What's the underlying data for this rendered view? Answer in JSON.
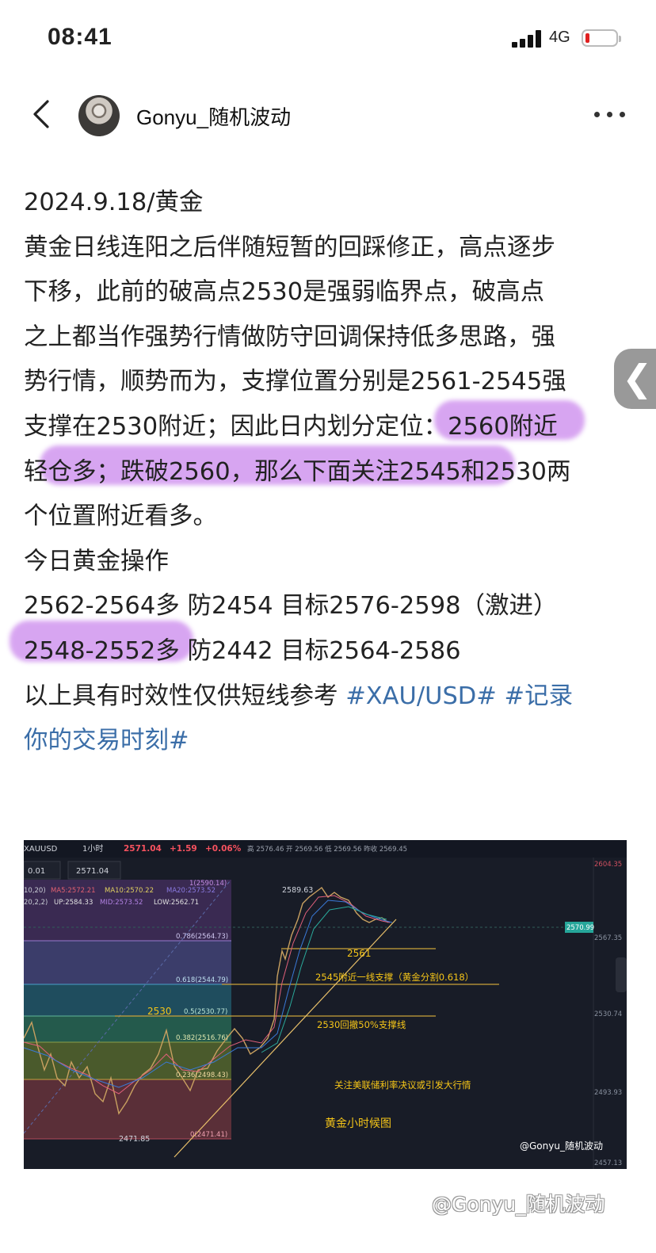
{
  "status_bar": {
    "time": "08:41",
    "network": "4G",
    "battery_level": 0.1
  },
  "header": {
    "author": "Gonyu_随机波动"
  },
  "post": {
    "lines": [
      "2024.9.18/黄金",
      "黄金日线连阳之后伴随短暂的回踩修正，高点逐步",
      "下移，此前的破高点2530是强弱临界点，破高点",
      "之上都当作强势行情做防守回调保持低多思路，强",
      "势行情，顺势而为，支撑位置分别是2561-2545强",
      "支撑在2530附近；因此日内划分定位：2560附近",
      "轻仓多；跌破2560，那么下面关注2545和2530两",
      "个位置附近看多。",
      "今日黄金操作",
      "2562-2564多 防2454 目标2576-2598（激进）",
      "2548-2552多 防2442 目标2564-2586"
    ],
    "last_line_text": "以上具有时效性仅供短线参考 ",
    "tag_1": "#XAU/USD#",
    "tag_2a": "#记录",
    "tag_2b": "你的交易时刻#"
  },
  "chart": {
    "symbol": "XAUUSD",
    "interval": "1小时",
    "price": "2571.04",
    "change": "+1.59",
    "change_pct": "+0.06%",
    "ohlc_text": "高 2576.46 开 2569.56 低 2569.56 昨收 2569.45",
    "qty_input": "0.01",
    "price_input": "2571.04",
    "ma_line": {
      "prefix": "10,20)",
      "ma5": "MA5:2572.21",
      "ma10": "MA10:2570.22",
      "ma20": "MA20:2573.52"
    },
    "boll_line": {
      "prefix": "20,2,2)",
      "up": "UP:2584.33",
      "mid": "MID:2573.52",
      "low": "LOW:2562.71"
    },
    "fib_labels": [
      "1(2590.14)",
      "0.786(2564.73)",
      "0.618(2544.79)",
      "0.5(2530.77)",
      "0.382(2516.76)",
      "0.236(2498.43)",
      "0(2471.41)"
    ],
    "price_axis": [
      "2604.35",
      "2567.35",
      "2530.74",
      "2493.93",
      "2457.13"
    ],
    "current_price_tag": "2570.99",
    "high_label": "2589.63",
    "low_label": "2471.85",
    "annotations": {
      "a2561": "2561",
      "a2545": "2545附近一线支撑（黄金分割0.618）",
      "a2530": "2530",
      "a2530b": "2530回撤50%支撑线",
      "fed": "关注美联储利率决议或引发大行情",
      "title": "黄金小时候图",
      "credit": "@Gonyu_随机波动"
    },
    "colors": {
      "bg": "#181c27",
      "up": "#26a69a",
      "down": "#ef5350",
      "annotation": "#f5c518"
    }
  },
  "watermark": "@Gonyu_随机波动"
}
